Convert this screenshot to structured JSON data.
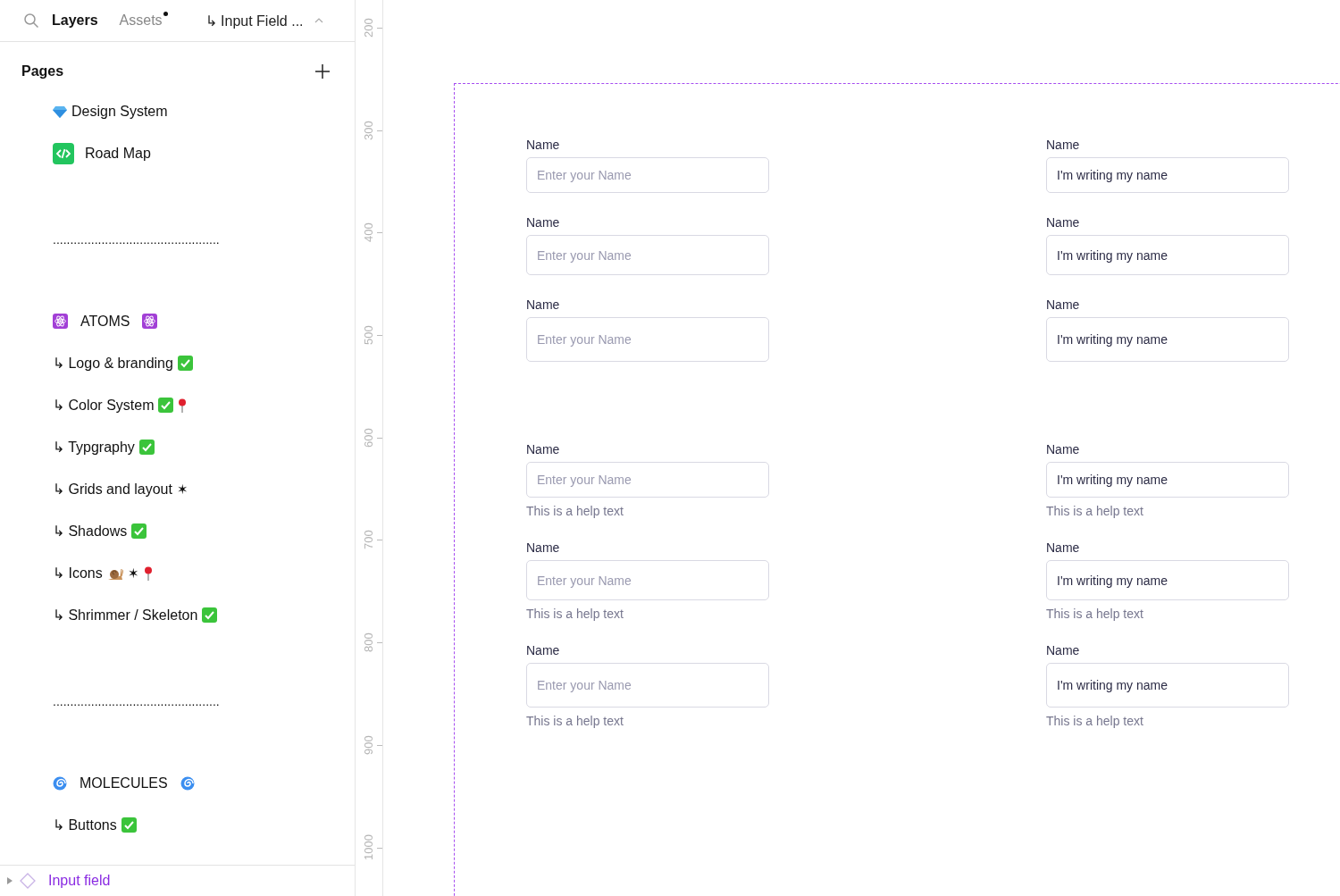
{
  "sidebar": {
    "tabs": [
      {
        "label": "Layers",
        "selected": true,
        "has_update": false
      },
      {
        "label": "Assets",
        "selected": false,
        "has_update": true
      }
    ],
    "breadcrumb": "↳ Input Field ...",
    "pages_title": "Pages",
    "pages": [
      {
        "kind": "page",
        "label": "Design System",
        "lead": {
          "kind": "gem"
        }
      },
      {
        "kind": "page",
        "label": "Road Map",
        "lead": {
          "kind": "code"
        }
      },
      {
        "kind": "separator",
        "label": "................................................"
      },
      {
        "kind": "section",
        "label": "ATOMS",
        "lead": {
          "kind": "atom"
        },
        "trail": [
          {
            "kind": "atom"
          }
        ]
      },
      {
        "kind": "page",
        "label": "↳ Logo & branding",
        "trail": [
          {
            "kind": "check"
          }
        ]
      },
      {
        "kind": "page",
        "label": "↳ Color System",
        "trail": [
          {
            "kind": "check"
          },
          {
            "kind": "pin"
          }
        ]
      },
      {
        "kind": "page",
        "label": "↳ Typgraphy",
        "trail": [
          {
            "kind": "check"
          }
        ]
      },
      {
        "kind": "page",
        "label": "↳ Grids and layout",
        "trail": [
          {
            "kind": "text",
            "text": "✶"
          }
        ]
      },
      {
        "kind": "page",
        "label": "↳ Shadows",
        "trail": [
          {
            "kind": "check"
          }
        ]
      },
      {
        "kind": "page",
        "label": "↳ Icons",
        "trail": [
          {
            "kind": "snail"
          },
          {
            "kind": "text",
            "text": "✶"
          },
          {
            "kind": "pin"
          }
        ]
      },
      {
        "kind": "page",
        "label": "↳ Shrimmer / Skeleton",
        "trail": [
          {
            "kind": "check"
          }
        ]
      },
      {
        "kind": "separator",
        "label": "................................................"
      },
      {
        "kind": "section",
        "label": "MOLECULES",
        "lead": {
          "kind": "spiral"
        },
        "trail": [
          {
            "kind": "spiral"
          }
        ]
      },
      {
        "kind": "page",
        "label": "↳ Buttons",
        "trail": [
          {
            "kind": "check"
          }
        ]
      }
    ],
    "layer": {
      "label": "Input field",
      "expanded": false
    }
  },
  "ruler": [
    "200",
    "300",
    "400",
    "500",
    "600",
    "700",
    "800",
    "900",
    "1000"
  ],
  "canvas": {
    "columns": [
      {
        "groups": [
          [
            {
              "label": "Name",
              "placeholder": "Enter your Name",
              "kind": "small"
            },
            {
              "label": "Name",
              "placeholder": "Enter your Name",
              "kind": "medium"
            },
            {
              "label": "Name",
              "placeholder": "Enter your Name",
              "kind": "large"
            }
          ],
          [
            {
              "label": "Name",
              "placeholder": "Enter your Name",
              "kind": "small",
              "help": "This is a help text"
            },
            {
              "label": "Name",
              "placeholder": "Enter your Name",
              "kind": "medium",
              "help": "This is a help text"
            },
            {
              "label": "Name",
              "placeholder": "Enter your Name",
              "kind": "large",
              "help": "This is a help text"
            }
          ]
        ]
      },
      {
        "groups": [
          [
            {
              "label": "Name",
              "value": "I'm writing my name",
              "kind": "small"
            },
            {
              "label": "Name",
              "value": "I'm writing my name",
              "kind": "medium"
            },
            {
              "label": "Name",
              "value": "I'm writing my name",
              "kind": "large"
            }
          ],
          [
            {
              "label": "Name",
              "value": "I'm writing my name",
              "kind": "small",
              "help": "This is a help text"
            },
            {
              "label": "Name",
              "value": "I'm writing my name",
              "kind": "medium",
              "help": "This is a help text"
            },
            {
              "label": "Name",
              "value": "I'm writing my name",
              "kind": "large",
              "help": "This is a help text"
            }
          ]
        ]
      }
    ]
  }
}
